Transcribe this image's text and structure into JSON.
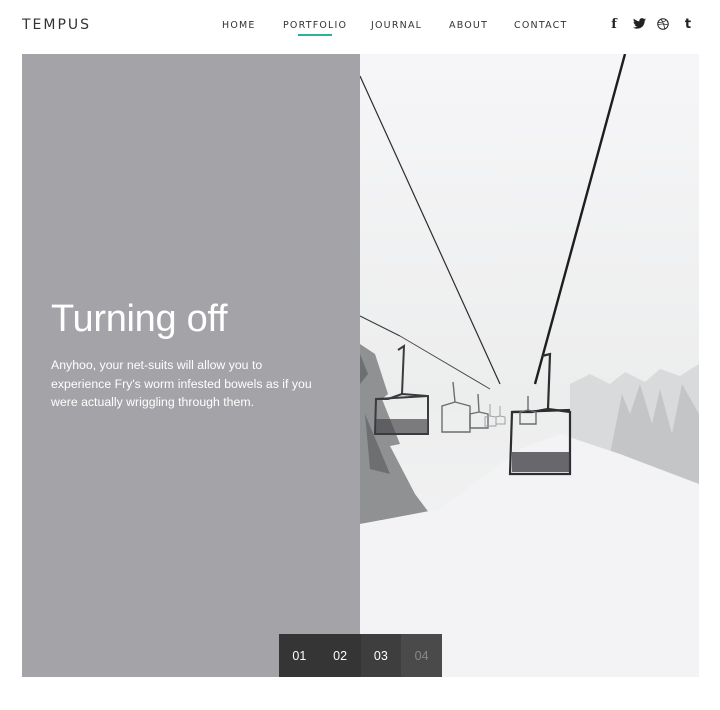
{
  "brand": {
    "name": "TEMPUS"
  },
  "nav": {
    "items": [
      {
        "label": "HOME",
        "active": false
      },
      {
        "label": "PORTFOLIO",
        "active": true
      },
      {
        "label": "JOURNAL",
        "active": false
      },
      {
        "label": "ABOUT",
        "active": false
      },
      {
        "label": "CONTACT",
        "active": false
      }
    ]
  },
  "social": {
    "icons": [
      "facebook-icon",
      "twitter-icon",
      "dribbble-icon",
      "tumblr-icon"
    ],
    "facebook": "f",
    "tumblr": "t"
  },
  "slide": {
    "title": "Turning off",
    "text": "Anyhoo, your net-suits will allow you to experience Fry's worm infested bowels as if you were actually wriggling through them."
  },
  "pager": {
    "items": [
      "01",
      "02",
      "03",
      "04"
    ],
    "current": "03"
  },
  "colors": {
    "accent": "#2bb39a",
    "panel": "#a4a3a7"
  }
}
